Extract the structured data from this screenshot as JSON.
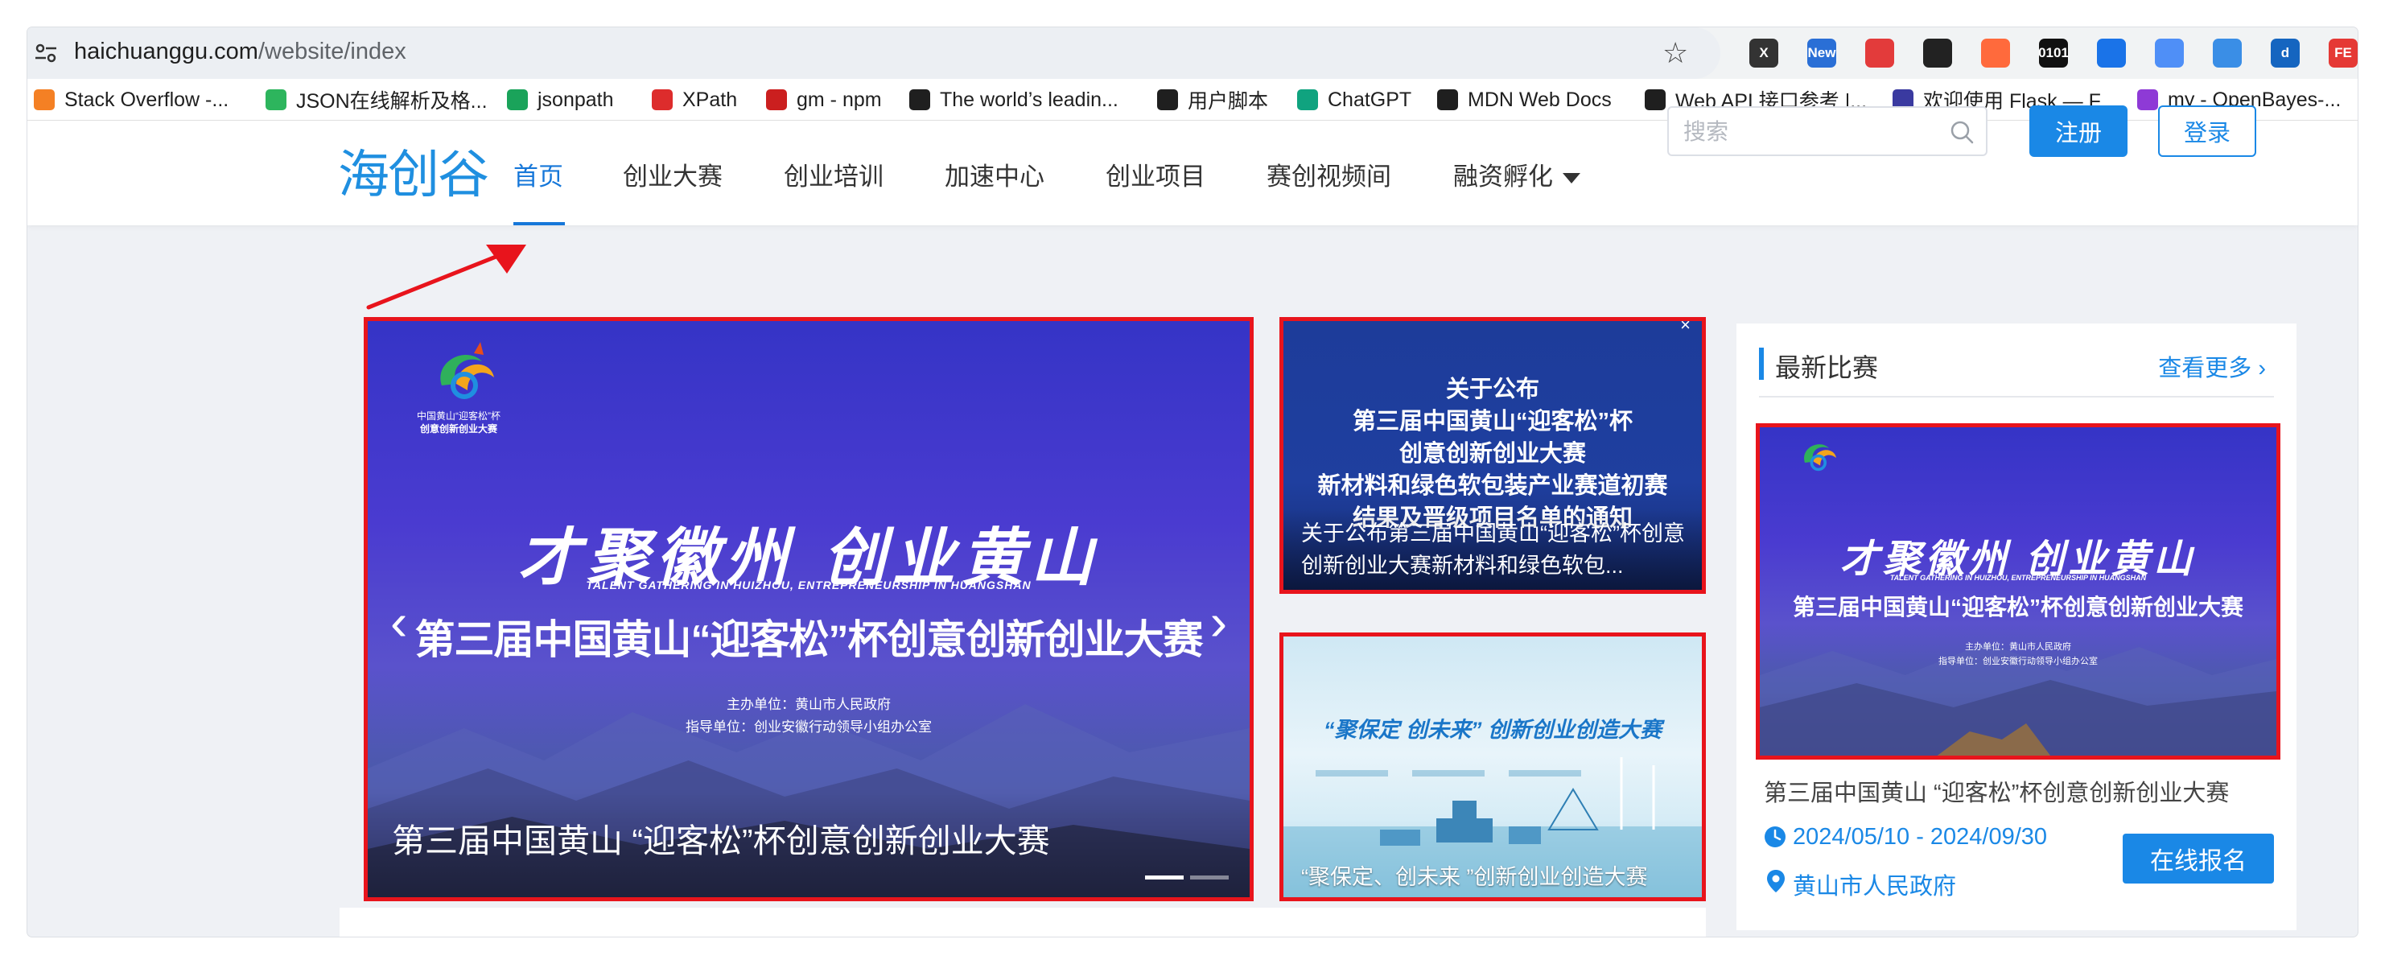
{
  "browser": {
    "url_host": "haichuanggu.com",
    "url_path": "/website/index",
    "extensions": [
      {
        "name": "x-icon",
        "text": "X",
        "color": "#333333"
      },
      {
        "name": "new-extension-icon",
        "text": "New",
        "color": "#2a6fd6"
      },
      {
        "name": "incognito-icon",
        "text": "",
        "color": "#e33b3b"
      },
      {
        "name": "tampermonkey-icon",
        "text": "",
        "color": "#222222"
      },
      {
        "name": "color-picker-icon",
        "text": "",
        "color": "#ff6a3c"
      },
      {
        "name": "binary-icon",
        "text": "0101",
        "color": "#111111"
      },
      {
        "name": "lightning-icon",
        "text": "",
        "color": "#1a73e8"
      },
      {
        "name": "screenshot-icon",
        "text": "",
        "color": "#4f8ff7"
      },
      {
        "name": "cloud-icon",
        "text": "",
        "color": "#3a8ee6"
      },
      {
        "name": "d-icon",
        "text": "d",
        "color": "#1565c0"
      },
      {
        "name": "fe-icon",
        "text": "FE",
        "color": "#e53935"
      }
    ]
  },
  "bookmarks": [
    {
      "label": "Stack Overflow -...",
      "icon": "stackoverflow-icon",
      "color": "#f48024"
    },
    {
      "label": "JSON在线解析及格...",
      "icon": "json-icon",
      "color": "#2db55d"
    },
    {
      "label": "jsonpath",
      "icon": "jsonpath-icon",
      "color": "#1aa35a"
    },
    {
      "label": "XPath",
      "icon": "angular-icon",
      "color": "#dd2c2c"
    },
    {
      "label": "gm - npm",
      "icon": "npm-icon",
      "color": "#cb1f1f"
    },
    {
      "label": "The world’s leadin...",
      "icon": "github-icon",
      "color": "#1f1f1f"
    },
    {
      "label": "用户脚本",
      "icon": "userscript-icon",
      "color": "#1f1f1f"
    },
    {
      "label": "ChatGPT",
      "icon": "chatgpt-icon",
      "color": "#10a37f"
    },
    {
      "label": "MDN Web Docs",
      "icon": "mdn-icon",
      "color": "#1f1f1f"
    },
    {
      "label": "Web API 接口参考 |...",
      "icon": "mdn-icon",
      "color": "#1f1f1f"
    },
    {
      "label": "欢迎使用 Flask — F...",
      "icon": "flask-icon",
      "color": "#3a3aa0"
    },
    {
      "label": "my - OpenBayes-...",
      "icon": "openbayes-icon",
      "color": "#8e3ad6"
    }
  ],
  "site": {
    "logo": "海创谷",
    "nav": [
      {
        "label": "首页",
        "active": true
      },
      {
        "label": "创业大赛",
        "active": false
      },
      {
        "label": "创业培训",
        "active": false
      },
      {
        "label": "加速中心",
        "active": false
      },
      {
        "label": "创业项目",
        "active": false
      },
      {
        "label": "赛创视频间",
        "active": false
      },
      {
        "label": "融资孵化",
        "active": false
      }
    ],
    "search_placeholder": "搜索",
    "register": "注册",
    "login": "登录"
  },
  "banner": {
    "logo_caption_1": "中国黄山“迎客松”杯",
    "logo_caption_2": "创意创新创业大赛",
    "slogan": "才聚徽州  创业黄山",
    "slogan_en": "TALENT GATHERING IN HUIZHOU, ENTREPRENEURSHIP IN HUANGSHAN",
    "headline": "第三届中国黄山“迎客松”杯创意创新创业大赛",
    "host": "主办单位：黄山市人民政府",
    "guide": "指导单位：创业安徽行动领导小组办公室",
    "caption": "第三届中国黄山 “迎客松”杯创意创新创业大赛",
    "prev_arrow": "‹",
    "next_arrow": "›"
  },
  "side_card_1": {
    "lines": [
      "关于公布",
      "第三届中国黄山“迎客松”杯",
      "创意创新创业大赛",
      "新材料和绿色软包装产业赛道初赛",
      "结果及晋级项目名单的通知"
    ],
    "caption": "关于公布第三届中国黄山“迎客松”杯创意创新创业大赛新材料和绿色软包...",
    "close": "×"
  },
  "side_card_2": {
    "title": "“聚保定 创未来” 创新创业创造大赛",
    "caption": "“聚保定、创未来 ”创新创业创造大赛"
  },
  "competition_panel": {
    "title": "最新比赛",
    "more": "查看更多",
    "more_chevron": "›",
    "image_slogan": "才聚徽州  创业黄山",
    "image_slogan_en": "TALENT GATHERING IN HUIZHOU, ENTREPRENEURSHIP IN HUANGSHAN",
    "image_headline": "第三届中国黄山“迎客松”杯创意创新创业大赛",
    "image_host": "主办单位：黄山市人民政府",
    "image_guide": "指导单位：创业安徽行动领导小组办公室",
    "name": "第三届中国黄山 “迎客松”杯创意创新创业大赛",
    "date_range": "2024/05/10 - 2024/09/30",
    "organizer": "黄山市人民政府",
    "signup": "在线报名"
  },
  "colors": {
    "accent": "#1a88e6",
    "highlight_border": "#e8141c",
    "annotation_arrow": "#e8141c"
  }
}
